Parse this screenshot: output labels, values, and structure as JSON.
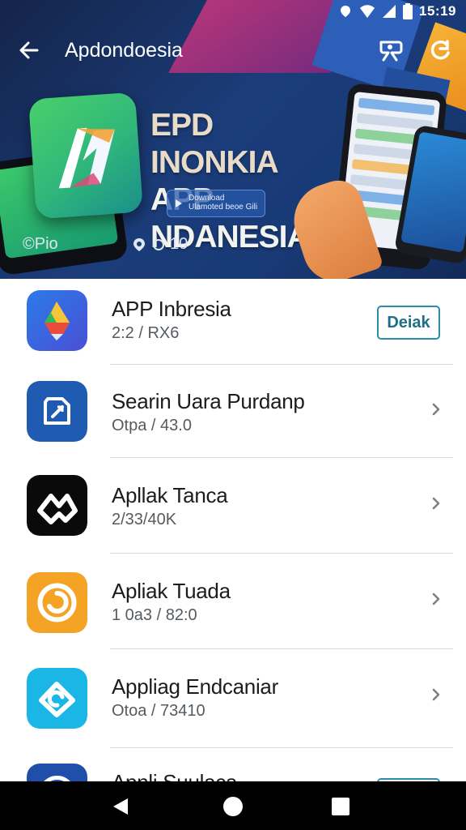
{
  "status_bar": {
    "time": "15:19",
    "icons": [
      "notification-dot-icon",
      "wifi-icon",
      "signal-icon",
      "battery-icon"
    ]
  },
  "toolbar": {
    "title": "Apdondoesia",
    "back_icon": "arrow-left-icon",
    "actions": [
      "user-edit-icon",
      "sync-icon"
    ]
  },
  "banner": {
    "headline_line1": "EPD INONKIA",
    "headline_line2": "APP NDANESIA",
    "button_text": "Download Ulamoted beoe Gili",
    "footer_text": "©Pio",
    "rating_text": "10",
    "colors": {
      "background": "#1b3c78",
      "accent_pink": "#c2367a",
      "accent_orange": "#f6b337",
      "logo_green": "#2fb67b"
    }
  },
  "apps": [
    {
      "name": "APP Inbresia",
      "subtitle": "2:2 / RX6",
      "action_label": "Deiak",
      "icon": "google-drive-icon"
    },
    {
      "name": "Searin Uara Purdanp",
      "subtitle": "Otpa / 43.0",
      "icon": "edit-share-icon"
    },
    {
      "name": "Apllak Tanca",
      "subtitle": "2/33/40K",
      "icon": "capcut-icon"
    },
    {
      "name": "Apliak Tuada",
      "subtitle": "1 0a3 / 82:0",
      "icon": "target-swirl-icon"
    },
    {
      "name": "Appliag Endcaniar",
      "subtitle": "Otoa / 73410",
      "icon": "refresh-ring-icon"
    },
    {
      "name": "Apnli Suulaca",
      "subtitle": "",
      "action_label": "",
      "icon": "blue-app-icon"
    }
  ],
  "nav": {
    "buttons": [
      "back-triangle-icon",
      "home-circle-icon",
      "recents-square-icon"
    ]
  },
  "colors": {
    "button_border": "#2a8ea8",
    "divider": "#d9dadc",
    "text_primary": "#1c1c1c",
    "text_secondary": "#555b61"
  }
}
